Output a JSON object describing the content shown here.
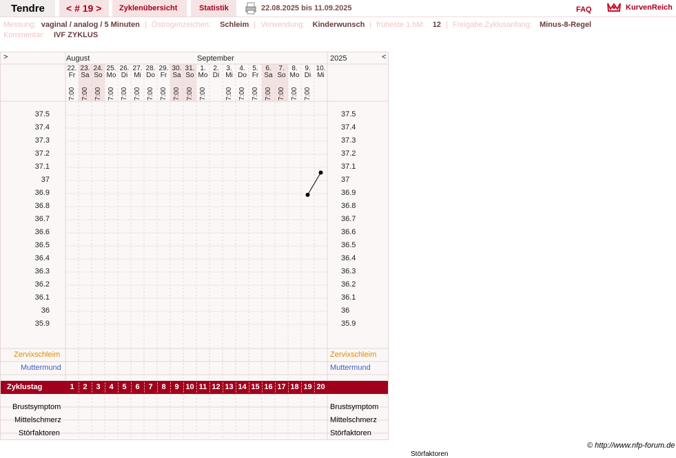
{
  "header": {
    "user_name": "Tendre",
    "cycle_nav": "< # 19 >",
    "tab_overview": "Zyklenübersicht",
    "tab_stats": "Statistik",
    "date_range": "22.08.2025 bis 11.09.2025",
    "faq": "FAQ",
    "logo_text": "KurvenReich"
  },
  "info": {
    "messung_label": "Messung:",
    "messung_value": "vaginal / analog / 5 Minuten",
    "oestrogen_label": "Östrogenzeichen:",
    "oestrogen_value": "Schleim",
    "verwendung_label": "Verwendung:",
    "verwendung_value": "Kinderwunsch",
    "fruehste_label": "früheste 1.hM:",
    "fruehste_value": "12",
    "freigabe_label": "Freigabe Zyklusanfang:",
    "freigabe_value": "Minus-8-Regel",
    "kommentar_label": "Kommentar:",
    "kommentar_value": "IVF ZYKLUS"
  },
  "chart": {
    "scroll_left": ">",
    "scroll_right": "<",
    "month_aug": "August",
    "month_sep": "September",
    "year": "2025",
    "days": [
      {
        "d": "22.",
        "w": "Fr",
        "t": "7:00"
      },
      {
        "d": "23.",
        "w": "Sa",
        "t": "7:00"
      },
      {
        "d": "24.",
        "w": "So",
        "t": "7:00"
      },
      {
        "d": "25.",
        "w": "Mo",
        "t": "7:00"
      },
      {
        "d": "26.",
        "w": "Di",
        "t": "7:00"
      },
      {
        "d": "27.",
        "w": "Mi",
        "t": "7:00"
      },
      {
        "d": "28.",
        "w": "Do",
        "t": "7:00"
      },
      {
        "d": "29.",
        "w": "Fr",
        "t": "7:00"
      },
      {
        "d": "30.",
        "w": "Sa",
        "t": "7:00"
      },
      {
        "d": "31.",
        "w": "So",
        "t": "7:00"
      },
      {
        "d": "1.",
        "w": "Mo",
        "t": "7:00"
      },
      {
        "d": "2.",
        "w": "Di",
        "t": ""
      },
      {
        "d": "3.",
        "w": "Mi",
        "t": "7:00"
      },
      {
        "d": "4.",
        "w": "Do",
        "t": "7:00"
      },
      {
        "d": "5.",
        "w": "Fr",
        "t": "7:00"
      },
      {
        "d": "6.",
        "w": "Sa",
        "t": "7:00"
      },
      {
        "d": "7.",
        "w": "So",
        "t": "7:00"
      },
      {
        "d": "8.",
        "w": "Mo",
        "t": "7:00"
      },
      {
        "d": "9.",
        "w": "Di",
        "t": "7:00"
      },
      {
        "d": "10.",
        "w": "Mi",
        "t": ""
      }
    ],
    "temp_labels": [
      "37.5",
      "37.4",
      "37.3",
      "37.2",
      "37.1",
      "37",
      "36.9",
      "36.8",
      "36.7",
      "36.6",
      "36.5",
      "36.4",
      "36.3",
      "36.2",
      "36.1",
      "36",
      "35.9"
    ],
    "row_zervix": "Zervixschleim",
    "row_muttermund": "Muttermund",
    "row_zyklustag": "Zyklustag",
    "cycle_days": [
      "1",
      "2",
      "3",
      "4",
      "5",
      "6",
      "7",
      "8",
      "9",
      "10",
      "11",
      "12",
      "13",
      "14",
      "15",
      "16",
      "17",
      "18",
      "19",
      "20"
    ],
    "row_brust": "Brustsymptom",
    "row_mittel": "Mittelschmerz",
    "row_stoer": "Störfaktoren",
    "colors": {
      "accent": "#a0001c",
      "zervix": "#e08a00",
      "muttermund": "#3a5fc8"
    }
  },
  "chart_data": {
    "type": "line",
    "ylim": [
      35.9,
      37.5
    ],
    "points": [
      {
        "day_index": 18,
        "date": "9.",
        "value": 36.89
      },
      {
        "day_index": 19,
        "date": "10.",
        "value": 37.06
      }
    ]
  },
  "footer": {
    "copyright": "© http://www.nfp-forum.de",
    "stoer_under": "Störfaktoren"
  }
}
